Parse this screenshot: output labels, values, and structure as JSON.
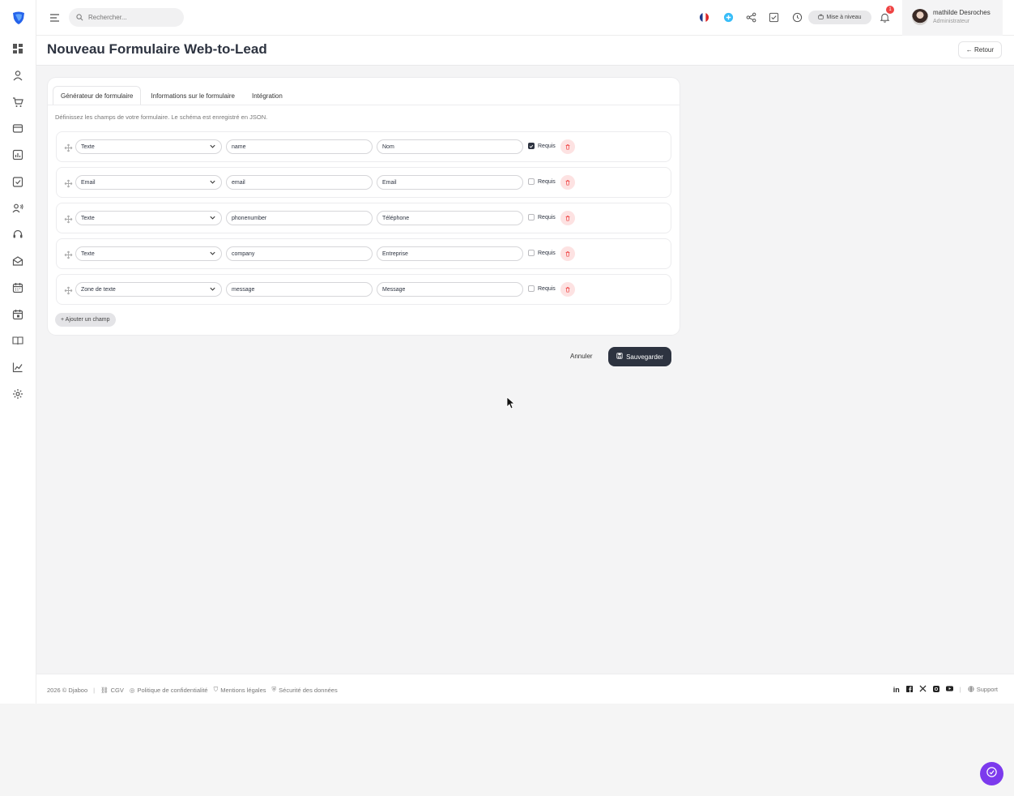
{
  "topbar": {
    "search_placeholder": "Rechercher...",
    "upgrade_label": "Mise à niveau",
    "notification_count": "1",
    "user_name": "mathilde Desroches",
    "user_role": "Administrateur"
  },
  "page": {
    "title": "Nouveau Formulaire Web-to-Lead",
    "back_label": "← Retour"
  },
  "tabs": [
    {
      "label": "Générateur de formulaire",
      "active": true
    },
    {
      "label": "Informations sur le formulaire",
      "active": false
    },
    {
      "label": "Intégration",
      "active": false
    }
  ],
  "hint": "Définissez les champs de votre formulaire. Le schéma est enregistré en JSON.",
  "fields": [
    {
      "type": "Texte",
      "name": "name",
      "label": "Nom",
      "required": true,
      "required_label": "Requis"
    },
    {
      "type": "Email",
      "name": "email",
      "label": "Email",
      "required": false,
      "required_label": "Requis"
    },
    {
      "type": "Texte",
      "name": "phonenumber",
      "label": "Téléphone",
      "required": false,
      "required_label": "Requis"
    },
    {
      "type": "Texte",
      "name": "company",
      "label": "Entreprise",
      "required": false,
      "required_label": "Requis"
    },
    {
      "type": "Zone de texte",
      "name": "message",
      "label": "Message",
      "required": false,
      "required_label": "Requis"
    }
  ],
  "add_field_label": "+ Ajouter un champ",
  "actions": {
    "cancel_label": "Annuler",
    "save_label": "Sauvegarder"
  },
  "footer": {
    "copyright": "2026 © Djaboo",
    "cgv": "CGV",
    "privacy": "Politique de confidentialité",
    "legal": "Mentions légales",
    "security": "Sécurité des données",
    "support": "Support",
    "social_linkedin": "in"
  },
  "colors": {
    "primary_dark": "#2d3340",
    "accent_purple": "#7c3aed",
    "danger_soft": "#fde2e2",
    "logo_blue": "#2563eb"
  }
}
